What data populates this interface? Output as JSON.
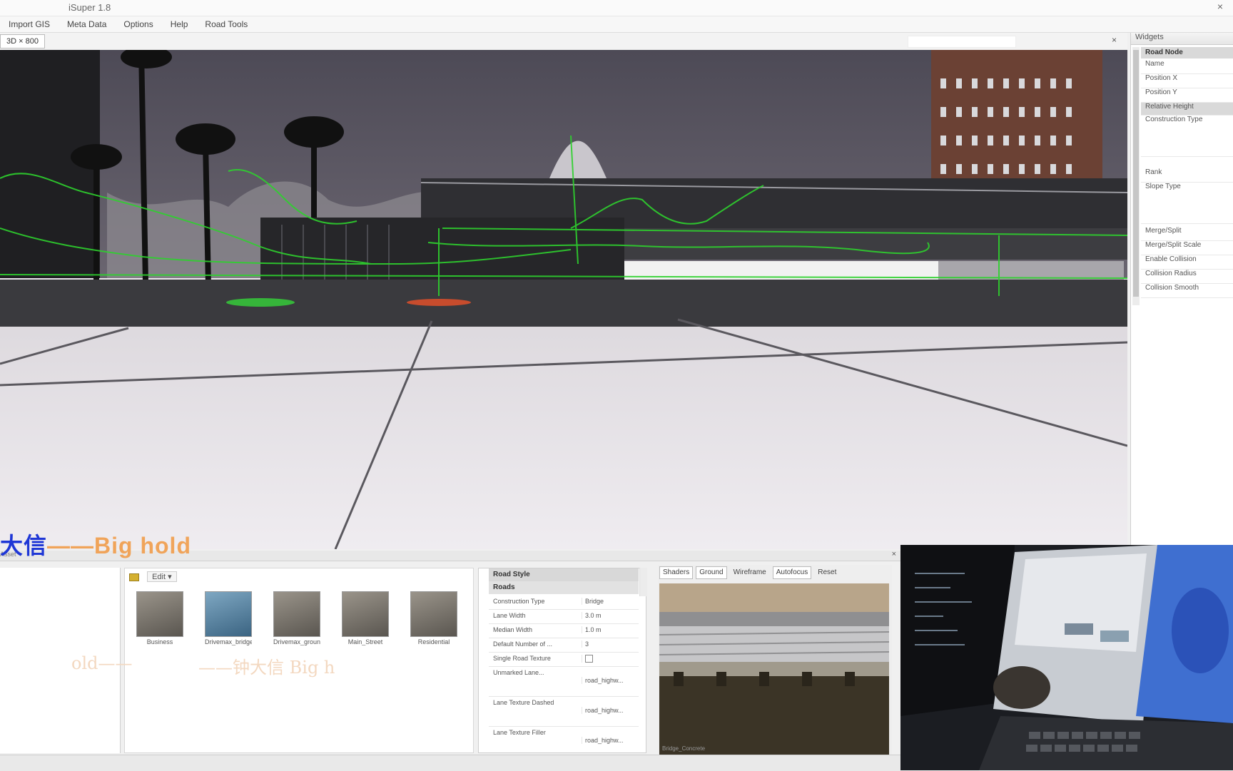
{
  "window": {
    "title": "iSuper 1.8",
    "close_glyph": "×"
  },
  "menu": [
    "Import GIS",
    "Meta Data",
    "Options",
    "Help",
    "Road Tools"
  ],
  "view_tab": "3D × 800",
  "view_close_glyph": "×",
  "right_panel": {
    "title": "Widgets",
    "group": "Road Node",
    "items": [
      "Name",
      "Position X",
      "Position Y",
      "Relative Height",
      "Construction Type",
      "Rank",
      "Slope Type",
      "Merge/Split",
      "Merge/Split Scale",
      "Enable Collision",
      "Collision Radius",
      "Collision Smooth"
    ]
  },
  "subtitle": {
    "cn": "大信",
    "en": "——Big hold"
  },
  "bottom_panel": {
    "header_label": "Asset",
    "close_glyph": "×",
    "gallery_toolbar": {
      "button": "Edit ▾"
    },
    "gallery_items": [
      "Business",
      "Drivemax_bridge",
      "Drivemax_ground",
      "Main_Street",
      "Residential"
    ],
    "faint_text_left": "old——",
    "faint_text_mid": "——钟大信 Big h"
  },
  "properties": {
    "header": "Road Style",
    "section": "Roads",
    "rows": [
      {
        "key": "Construction Type",
        "value": "Bridge"
      },
      {
        "key": "Lane Width",
        "value": "3.0 m"
      },
      {
        "key": "Median Width",
        "value": "1.0 m"
      },
      {
        "key": "Default Number of ...",
        "value": "3"
      },
      {
        "key": "Single Road Texture",
        "value": ""
      },
      {
        "key": "Unmarked Lane...",
        "value": "road_highw..."
      },
      {
        "key": "Lane Texture Dashed",
        "value": "road_highw..."
      },
      {
        "key": "Lane Texture Filler",
        "value": "road_highw..."
      }
    ]
  },
  "preview": {
    "tabs": [
      "Shaders",
      "Ground",
      "Wireframe",
      "Autofocus",
      "Reset"
    ],
    "footer": "Bridge_Concrete"
  },
  "colors": {
    "accent_green": "#2ed12e",
    "sky": "#5a5660",
    "ground": "#ebe8ec",
    "subtitle_blue": "#1f37d6",
    "subtitle_orange": "#f0a45a"
  }
}
